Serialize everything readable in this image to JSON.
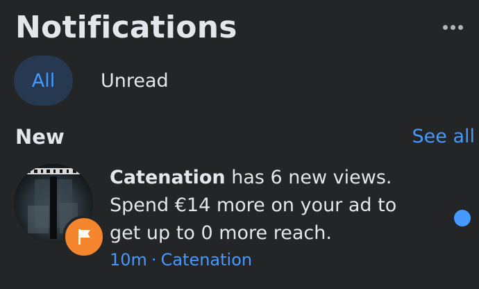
{
  "header": {
    "title": "Notifications",
    "more_icon": "more-horizontal-icon"
  },
  "filters": {
    "all_label": "All",
    "unread_label": "Unread",
    "active": "All"
  },
  "section": {
    "title": "New",
    "see_all_label": "See all"
  },
  "notifications": [
    {
      "page_name": "Catenation",
      "message_suffix": " has 6 new views.",
      "message_rest": "Spend €14 more on your ad to get up to 0 more reach.",
      "time": "10m",
      "separator": "·",
      "source": "Catenation",
      "unread": true,
      "avatar_icon": "page-avatar-image",
      "badge_icon": "flag-icon"
    }
  ],
  "colors": {
    "background": "#242526",
    "accent": "#4599ff",
    "active_tab_bg": "#263951",
    "badge": "#f5862e",
    "text": "#e4e6eb"
  }
}
